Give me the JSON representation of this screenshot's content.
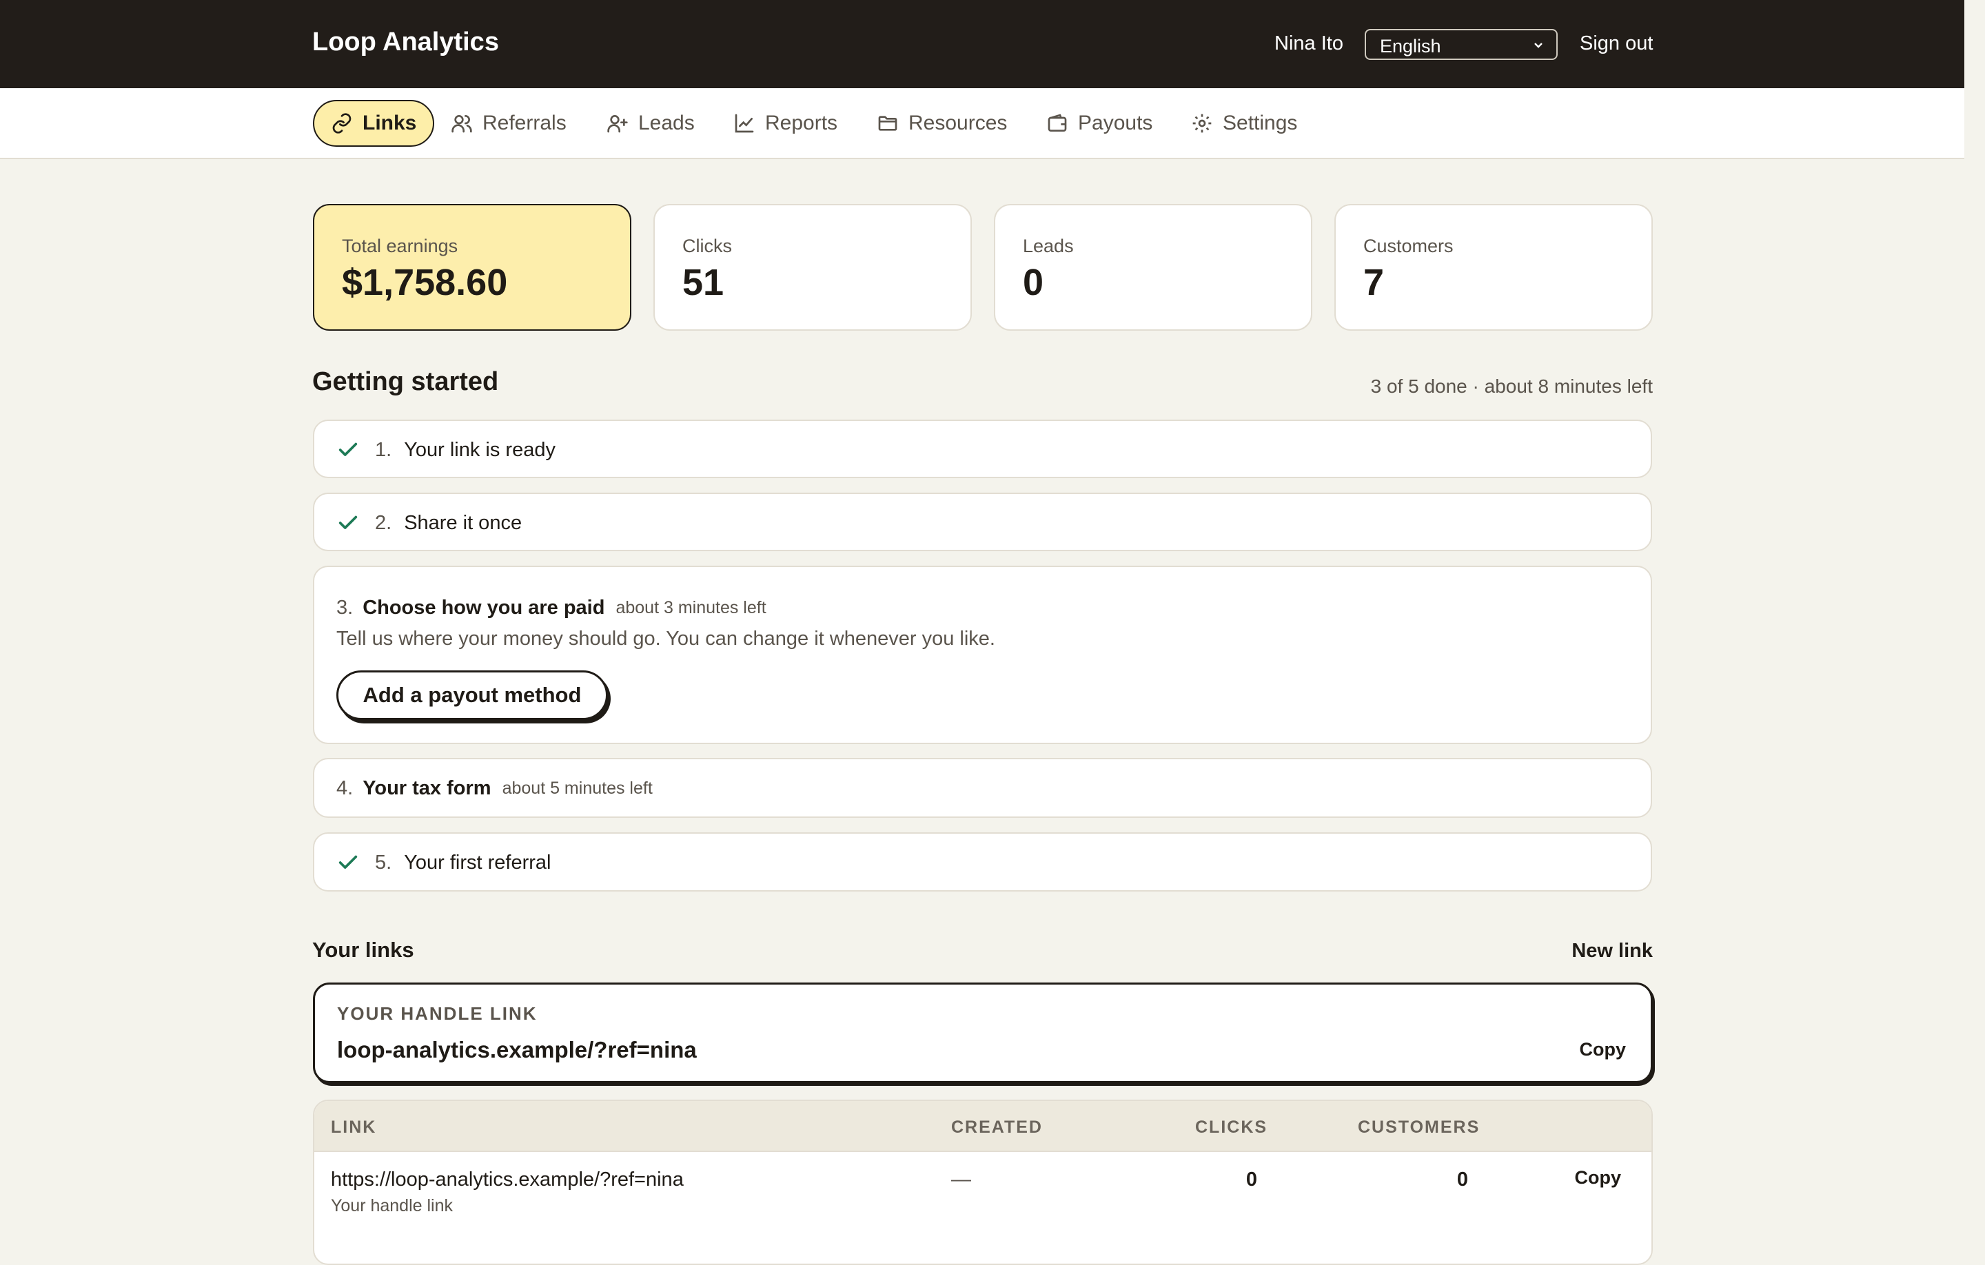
{
  "header": {
    "brand": "Loop Analytics",
    "user_name": "Nina Ito",
    "language": "English",
    "sign_out": "Sign out"
  },
  "nav": {
    "items": [
      {
        "label": "Links",
        "icon": "link-icon",
        "active": true
      },
      {
        "label": "Referrals",
        "icon": "users-icon"
      },
      {
        "label": "Leads",
        "icon": "user-plus-icon"
      },
      {
        "label": "Reports",
        "icon": "chart-icon"
      },
      {
        "label": "Resources",
        "icon": "folder-icon"
      },
      {
        "label": "Payouts",
        "icon": "wallet-icon"
      },
      {
        "label": "Settings",
        "icon": "gear-icon"
      }
    ]
  },
  "stats": [
    {
      "label": "Total earnings",
      "value": "$1,758.60"
    },
    {
      "label": "Clicks",
      "value": "51"
    },
    {
      "label": "Leads",
      "value": "0"
    },
    {
      "label": "Customers",
      "value": "7"
    }
  ],
  "getting_started": {
    "title": "Getting started",
    "progress": "3 of 5 done · about 8 minutes left",
    "tasks": [
      {
        "num": "1.",
        "title": "Your link is ready",
        "done": true
      },
      {
        "num": "2.",
        "title": "Share it once",
        "done": true
      },
      {
        "num": "3.",
        "title": "Choose how you are paid",
        "time": "about 3 minutes left",
        "desc": "Tell us where your money should go. You can change it whenever you like.",
        "action": "Add a payout method"
      },
      {
        "num": "4.",
        "title": "Your tax form",
        "time": "about 5 minutes left"
      },
      {
        "num": "5.",
        "title": "Your first referral",
        "done": true
      }
    ]
  },
  "links": {
    "title": "Your links",
    "new_link": "New link",
    "handle": {
      "label": "YOUR HANDLE LINK",
      "url": "loop-analytics.example/?ref=nina",
      "copy": "Copy"
    },
    "table": {
      "columns": [
        "LINK",
        "CREATED",
        "CLICKS",
        "CUSTOMERS"
      ],
      "rows": [
        {
          "url": "https://loop-analytics.example/?ref=nina",
          "sub": "Your handle link",
          "created": "—",
          "clicks": "0",
          "customers": "0",
          "copy": "Copy"
        }
      ]
    }
  },
  "colors": {
    "topbar": "#221d19",
    "accent": "#fdeea9",
    "check": "#1d7a56",
    "background": "#f4f3ec"
  }
}
